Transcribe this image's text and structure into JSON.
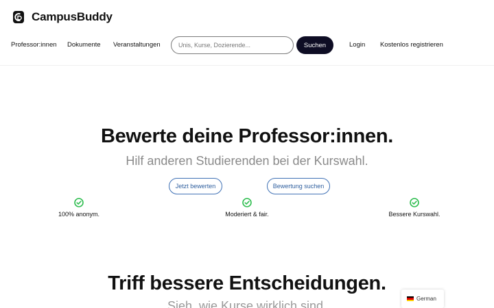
{
  "brand": {
    "name": "CampusBuddy"
  },
  "nav": {
    "professors": "Professor:innen",
    "documents": "Dokumente",
    "events": "Veranstaltungen",
    "login": "Login",
    "register": "Kostenlos registrieren"
  },
  "search": {
    "placeholder": "Unis, Kurse, Dozierende...",
    "button": "Suchen",
    "value": ""
  },
  "hero": {
    "title": "Bewerte deine Professor:innen.",
    "subtitle": "Hilf anderen Studierenden bei der Kurswahl.",
    "primary_button": "Jetzt bewerten",
    "secondary_button": "Bewertung suchen"
  },
  "features": [
    {
      "label": "100% anonym.",
      "icon": "check-circle-icon"
    },
    {
      "label": "Moderiert & fair.",
      "icon": "check-circle-icon"
    },
    {
      "label": "Bessere Kurswahl.",
      "icon": "check-circle-icon"
    }
  ],
  "section2": {
    "title": "Triff bessere Entscheidungen.",
    "subtitle": "Sieh, wie Kurse wirklich sind."
  },
  "language": {
    "label": "German",
    "flag": "germany-flag-icon"
  },
  "colors": {
    "accent_dark": "#0e0d24",
    "outline_blue": "#3d6fb4",
    "check_green": "#2ebd4f",
    "subtitle_gray": "#8a8a8a"
  }
}
